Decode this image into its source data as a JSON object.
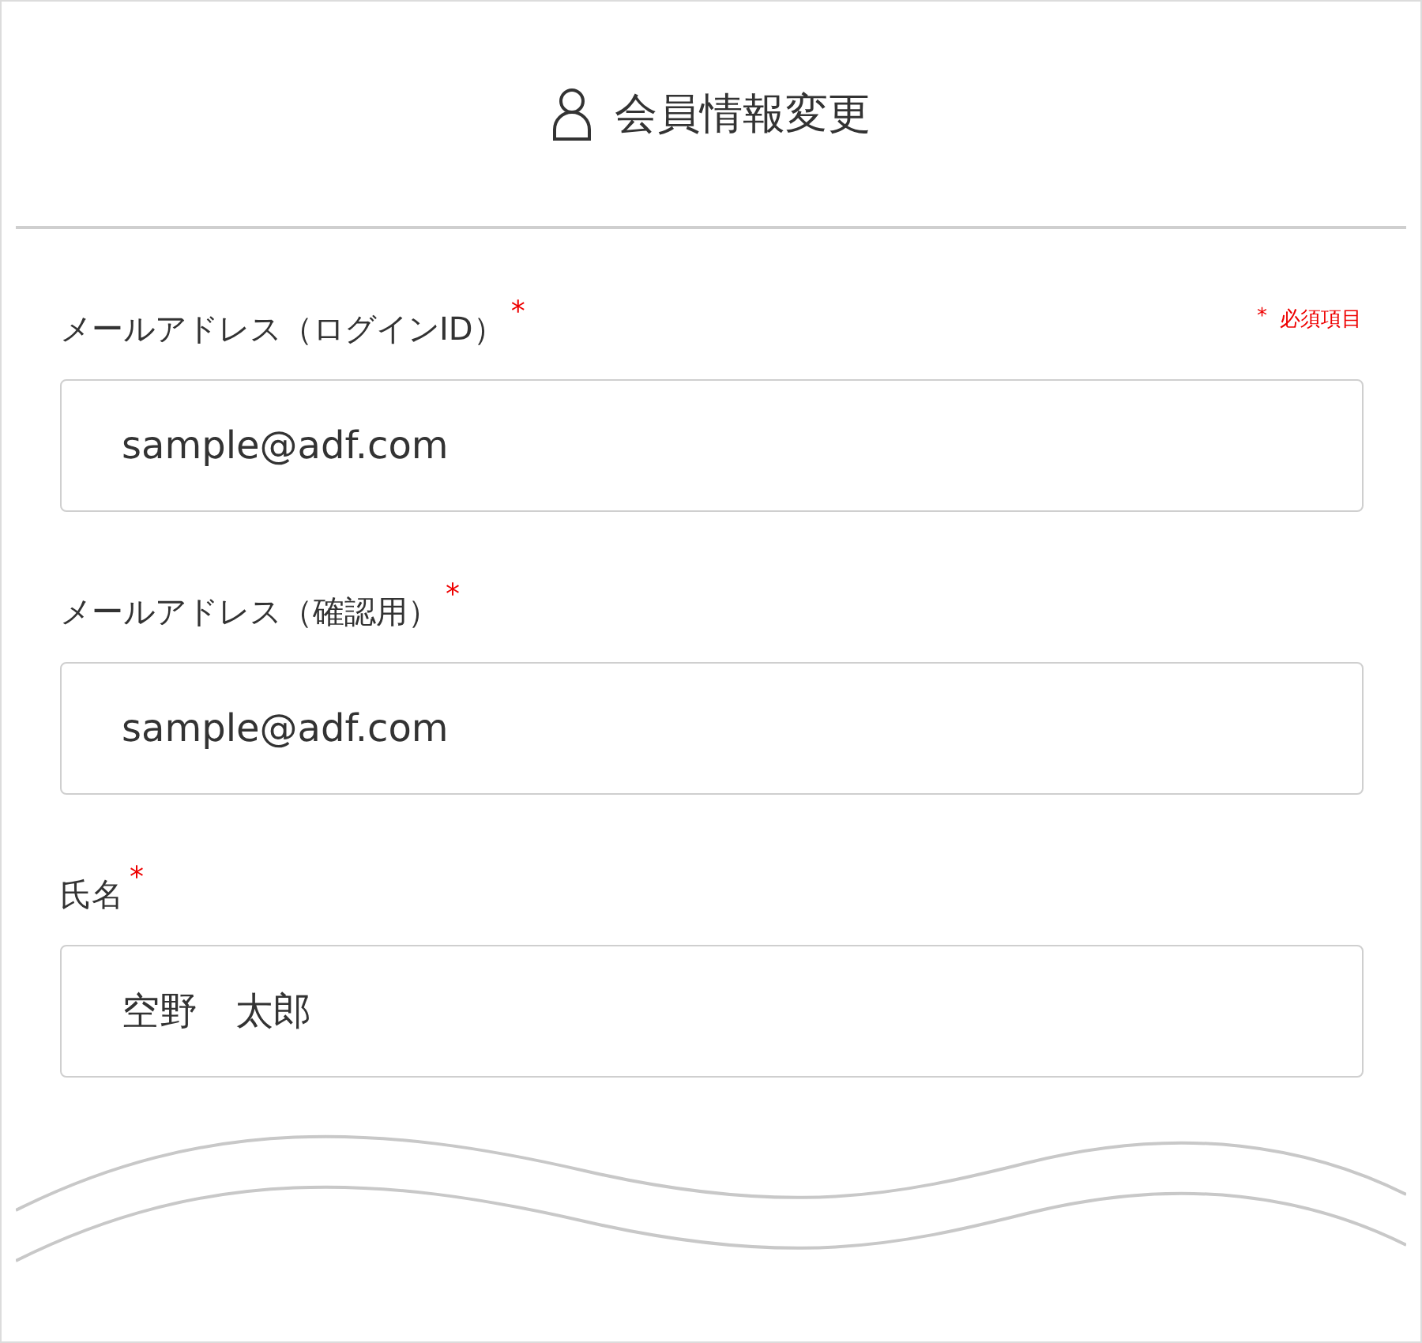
{
  "header": {
    "title": "会員情報変更"
  },
  "required_note": {
    "mark": "*",
    "text": "必須項目"
  },
  "fields": [
    {
      "label": "メールアドレス（ログインID）",
      "required": true,
      "value": "sample@adf.com"
    },
    {
      "label": "メールアドレス（確認用）",
      "required": true,
      "value": "sample@adf.com"
    },
    {
      "label": "氏名",
      "required": true,
      "value": "空野　太郎"
    }
  ]
}
